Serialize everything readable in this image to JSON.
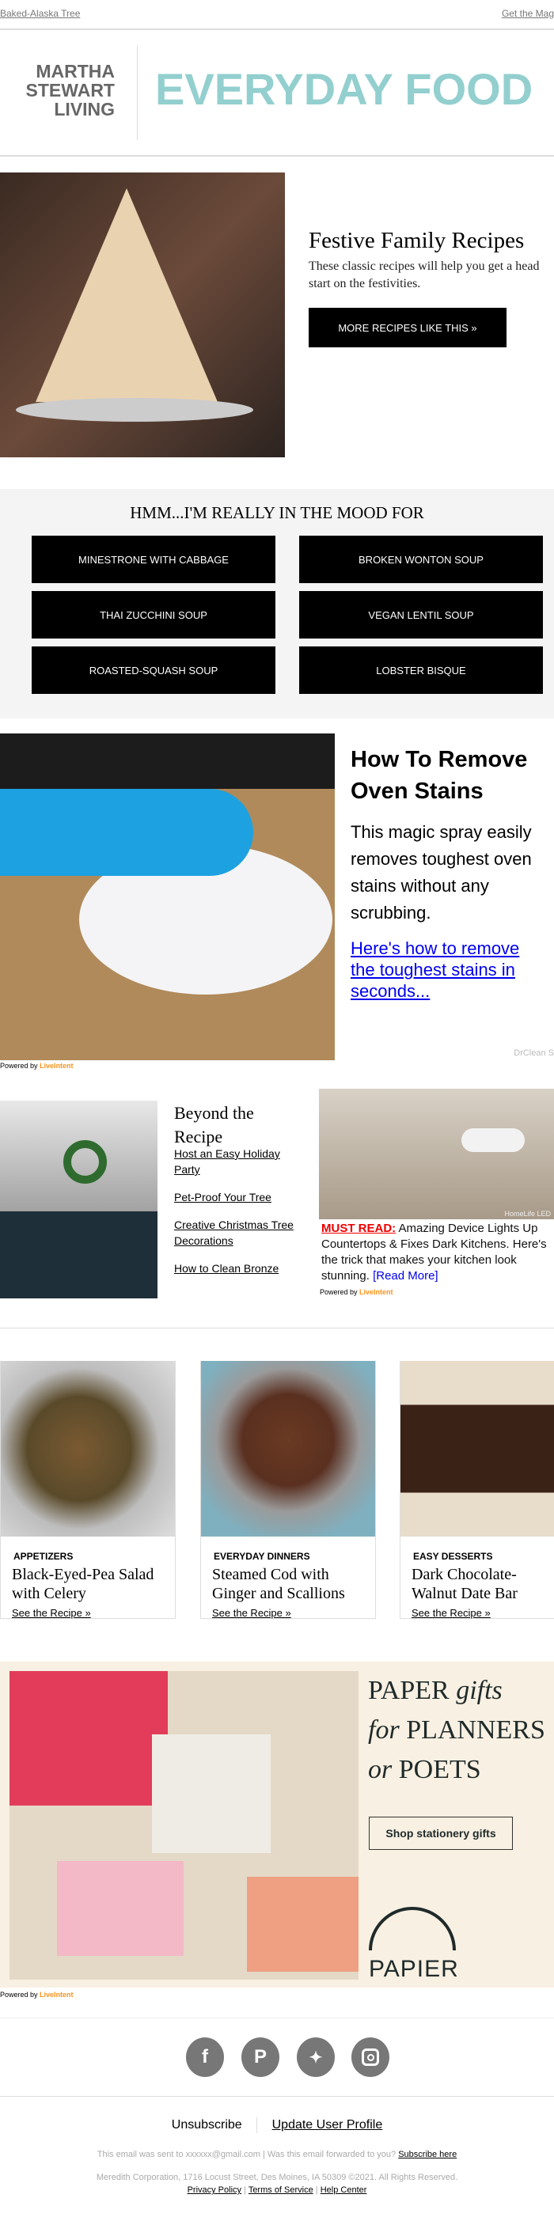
{
  "top": {
    "left_link": "Baked-Alaska Tree",
    "right_link": "Get the Mag"
  },
  "header": {
    "brand_lines": [
      "MARTHA",
      "STEWART",
      "LIVING"
    ],
    "title": "EVERYDAY FOOD",
    "accent": "#93cfcf"
  },
  "hero": {
    "title": "Festive Family Recipes",
    "text": "These classic recipes will help you get a head start on the festivities.",
    "button": "MORE RECIPES LIKE THIS »"
  },
  "mood": {
    "title": "HMM...I'M REALLY IN THE MOOD FOR",
    "buttons": [
      "MINESTRONE WITH CABBAGE",
      "BROKEN WONTON SOUP",
      "THAI ZUCCHINI SOUP",
      "VEGAN LENTIL SOUP",
      "ROASTED-SQUASH SOUP",
      "LOBSTER BISQUE"
    ]
  },
  "ad1": {
    "title": "How To Remove Oven Stains",
    "body": "This magic spray easily removes toughest oven stains without any scrubbing.",
    "link": "Here's how to remove the toughest stains in seconds...",
    "sponsor": "DrClean S",
    "powered": "Powered by",
    "brand": "LiveIntent"
  },
  "beyond": {
    "title": "Beyond the Recipe",
    "links": [
      "Host an Easy Holiday Party",
      "Pet-Proof Your Tree",
      "Creative Christmas Tree Decorations",
      "How to Clean Bronze"
    ]
  },
  "ad2": {
    "must": "MUST READ:",
    "body": "Amazing Device Lights Up Countertops & Fixes Dark Kitchens. Here's the trick that makes your kitchen look stunning.",
    "read_more": "[Read More]",
    "watermark": "HomeLife LED",
    "powered": "Powered by",
    "brand": "LiveIntent"
  },
  "cards": [
    {
      "category": "APPETIZERS",
      "title": "Black-Eyed-Pea Salad with Celery",
      "link": "See the Recipe »"
    },
    {
      "category": "EVERYDAY DINNERS",
      "title": "Steamed Cod with Ginger and Scallions",
      "link": "See the Recipe »"
    },
    {
      "category": "EASY DESSERTS",
      "title": "Dark Chocolate-Walnut Date Bar",
      "link": "See the Recipe »"
    }
  ],
  "ad3": {
    "headline_1": "PAPER",
    "headline_1i": "gifts",
    "headline_2i": "for",
    "headline_2": "PLANNERS",
    "headline_3i": "or",
    "headline_3": "POETS",
    "button": "Shop stationery gifts",
    "logo": "PAPIER",
    "powered": "Powered by",
    "brand": "LiveIntent"
  },
  "social": [
    "facebook-icon",
    "pinterest-icon",
    "twitter-icon",
    "instagram-icon"
  ],
  "footer": {
    "unsubscribe": "Unsubscribe",
    "update": "Update User Profile",
    "sent": "This email was sent to xxxxxx@gmail.com  |  Was this email forwarded to you?",
    "subscribe": "Subscribe here",
    "address": "Meredith Corporation, 1716 Locust Street, Des Moines, IA 50309 ©2021. All Rights Reserved.",
    "privacy": "Privacy Policy",
    "terms": "Terms of Service",
    "help": "Help Center"
  }
}
